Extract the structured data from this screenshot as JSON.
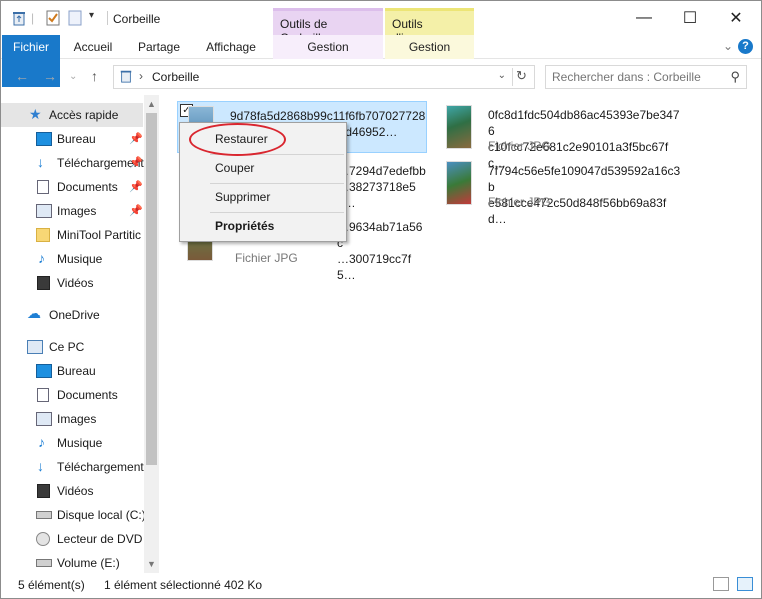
{
  "window": {
    "title": "Corbeille",
    "controls": {
      "minimize": "—",
      "maximize": "☐",
      "close": "✕"
    }
  },
  "context_tabs": [
    {
      "label": "Outils de Corbeille",
      "sub": "Gestion",
      "color": "#e9d4f2"
    },
    {
      "label": "Outils d'image",
      "sub": "Gestion",
      "color": "#f4f0a8"
    }
  ],
  "ribbon": {
    "tabs": [
      "Fichier",
      "Accueil",
      "Partage",
      "Affichage"
    ],
    "accent": "#1979ca",
    "help": "?",
    "collapse": "⌄"
  },
  "address": {
    "back": "←",
    "forward": "→",
    "recent": "⌄",
    "up": "↑",
    "separator": "›",
    "path": "Corbeille",
    "dropdown": "⌄",
    "refresh": "↻",
    "search_placeholder": "Rechercher dans : Corbeille"
  },
  "sidebar": {
    "items": [
      {
        "label": "Accès rapide",
        "icon": "star-icon",
        "pinned": false
      },
      {
        "label": "Bureau",
        "icon": "desktop-icon",
        "pinned": true
      },
      {
        "label": "Téléchargements",
        "icon": "download-icon",
        "pinned": true
      },
      {
        "label": "Documents",
        "icon": "documents-icon",
        "pinned": true
      },
      {
        "label": "Images",
        "icon": "images-icon",
        "pinned": true
      },
      {
        "label": "MiniTool Partitic",
        "icon": "folder-icon",
        "pinned": false
      },
      {
        "label": "Musique",
        "icon": "music-icon",
        "pinned": false
      },
      {
        "label": "Vidéos",
        "icon": "videos-icon",
        "pinned": false
      },
      {
        "label": "OneDrive",
        "icon": "cloud-icon",
        "pinned": false
      },
      {
        "label": "Ce PC",
        "icon": "pc-icon",
        "pinned": false
      },
      {
        "label": "Bureau",
        "icon": "desktop-icon",
        "pinned": false
      },
      {
        "label": "Documents",
        "icon": "documents-icon",
        "pinned": false
      },
      {
        "label": "Images",
        "icon": "images-icon",
        "pinned": false
      },
      {
        "label": "Musique",
        "icon": "music-icon",
        "pinned": false
      },
      {
        "label": "Téléchargement",
        "icon": "download-icon",
        "pinned": false
      },
      {
        "label": "Vidéos",
        "icon": "videos-icon",
        "pinned": false
      },
      {
        "label": "Disque local (C:)",
        "icon": "drive-icon",
        "pinned": false
      },
      {
        "label": "Lecteur de DVD (",
        "icon": "dvd-icon",
        "pinned": false
      },
      {
        "label": "Volume (E:)",
        "icon": "drive-icon",
        "pinned": false
      }
    ],
    "pin_glyph": "📌"
  },
  "files": [
    {
      "name": "9d78fa5d2868b99c11f6fb707027728",
      "name2": "…f82bf9d46952…",
      "type": "",
      "selected": true
    },
    {
      "name": "0fc8d1fdc504db86ac45393e7be3476",
      "name2": "c10fcc72e681c2e90101a3f5bc67fc…",
      "type": "Fichier JPG",
      "selected": false
    },
    {
      "name": "…7294d7edefbb",
      "name2": "…38273718e5e…",
      "type": "",
      "selected": false
    },
    {
      "name": "7f794c56e5fe109047d539592a16c3b",
      "name2": "e581cce472c50d848f56bb69a83fd…",
      "type": "Fichier JPG",
      "selected": false
    },
    {
      "name": "…9634ab71a56c",
      "name2": "…300719cc7f5…",
      "type": "Fichier JPG",
      "selected": false
    }
  ],
  "context_menu": {
    "items": [
      "Restaurer",
      "Couper",
      "Supprimer",
      "Propriétés"
    ],
    "highlight_color": "#d9262f"
  },
  "status": {
    "count": "5 élément(s)",
    "selection": "1 élément sélectionné  402 Ko"
  }
}
